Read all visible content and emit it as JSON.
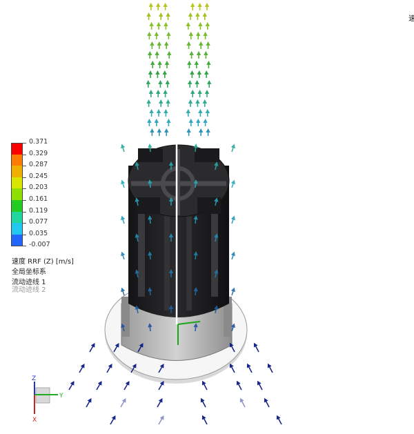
{
  "corner_text": "速",
  "legend": {
    "values": [
      "0.371",
      "0.329",
      "0.287",
      "0.245",
      "0.203",
      "0.161",
      "0.119",
      "0.077",
      "0.035",
      "-0.007"
    ],
    "colors": [
      "#ff0000",
      "#ff7a00",
      "#f0b000",
      "#d8e600",
      "#8fe000",
      "#22cc22",
      "#22d6a0",
      "#22c8f0",
      "#2266ff",
      "#0000cc"
    ]
  },
  "info": {
    "quantity": "速度 RRF (Z) [m/s]",
    "coord_system": "全局坐标系",
    "trajectory_1": "流动迹线 1",
    "trajectory_2": "流动迹线 2"
  },
  "triad": {
    "x": "X",
    "y": "Y",
    "z": "Z"
  },
  "colors": {
    "cylinder_dark": "#1c1c1e",
    "base_gray": "#b8b8b8",
    "disc_white": "#f4f4f4",
    "arrow_high": "#b7c400",
    "arrow_mid": "#2a9a2a",
    "arrow_low": "#0a1a8a"
  },
  "icons": [
    "arrow-icon",
    "coordinate-triad-icon"
  ]
}
